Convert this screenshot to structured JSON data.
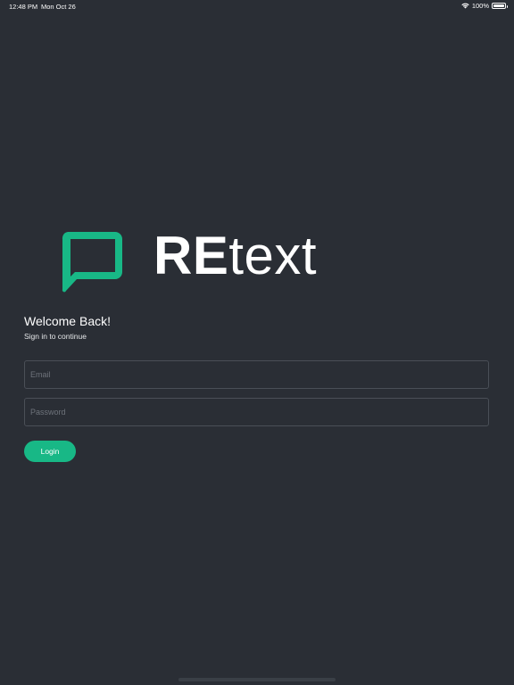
{
  "status_bar": {
    "time": "12:48 PM",
    "date": "Mon Oct 26",
    "battery": "100%"
  },
  "brand": {
    "name_bold": "RE",
    "name_light": "text",
    "accent_color": "#18b886",
    "logo_icon": "speech-bubble-icon"
  },
  "login": {
    "title": "Welcome Back!",
    "subtitle": "Sign in to continue",
    "email_placeholder": "Email",
    "email_value": "",
    "password_placeholder": "Password",
    "password_value": "",
    "button_label": "Login"
  },
  "colors": {
    "background": "#2a2e35",
    "field_border": "#4a4f57",
    "button": "#18b886"
  }
}
